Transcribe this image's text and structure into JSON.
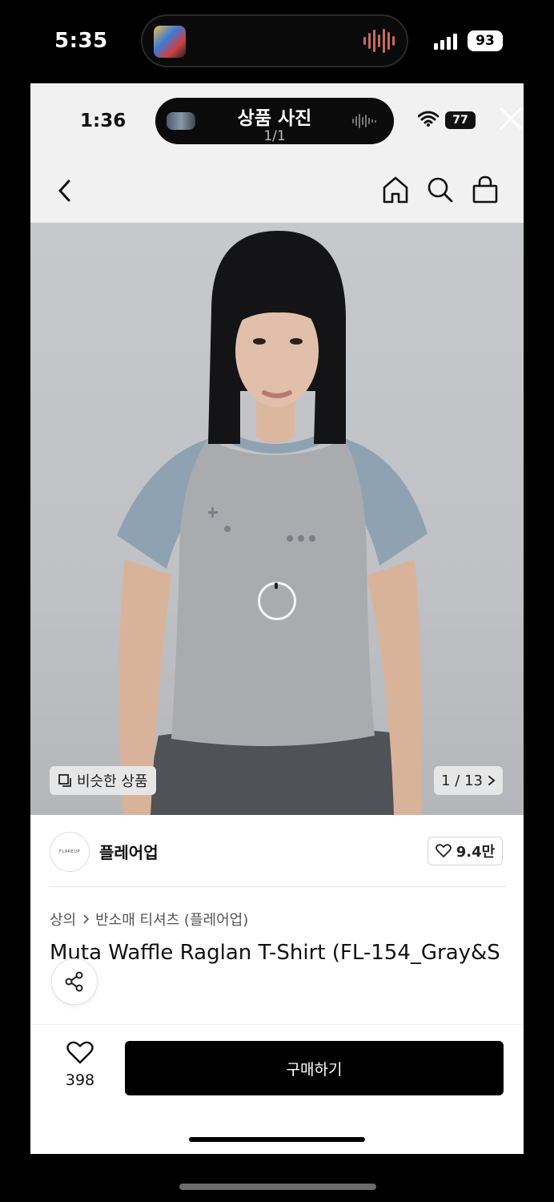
{
  "outer_status": {
    "time": "5:35",
    "battery": "93"
  },
  "inner_status": {
    "time": "1:36",
    "battery": "77"
  },
  "viewer": {
    "title": "상품 사진",
    "count": "1/1"
  },
  "photo": {
    "similar_label": "비슷한 상품",
    "counter": "1 / 13"
  },
  "brand": {
    "logo_text": "FLAREUP",
    "name": "플레어업",
    "likes": "9.4만"
  },
  "breadcrumb": {
    "category": "상의",
    "subcategory": "반소매 티셔츠 (플레어업)"
  },
  "product": {
    "title": "Muta Waffle Raglan T-Shirt (FL-154_Gray&S"
  },
  "bottom": {
    "wish_count": "398",
    "buy_label": "구매하기"
  },
  "icons": [
    "back-chevron-icon",
    "home-icon",
    "search-icon",
    "shopping-bag-icon",
    "close-icon",
    "heart-icon",
    "share-icon",
    "similar-items-icon",
    "chevron-right-icon",
    "wifi-icon",
    "signal-icon"
  ]
}
